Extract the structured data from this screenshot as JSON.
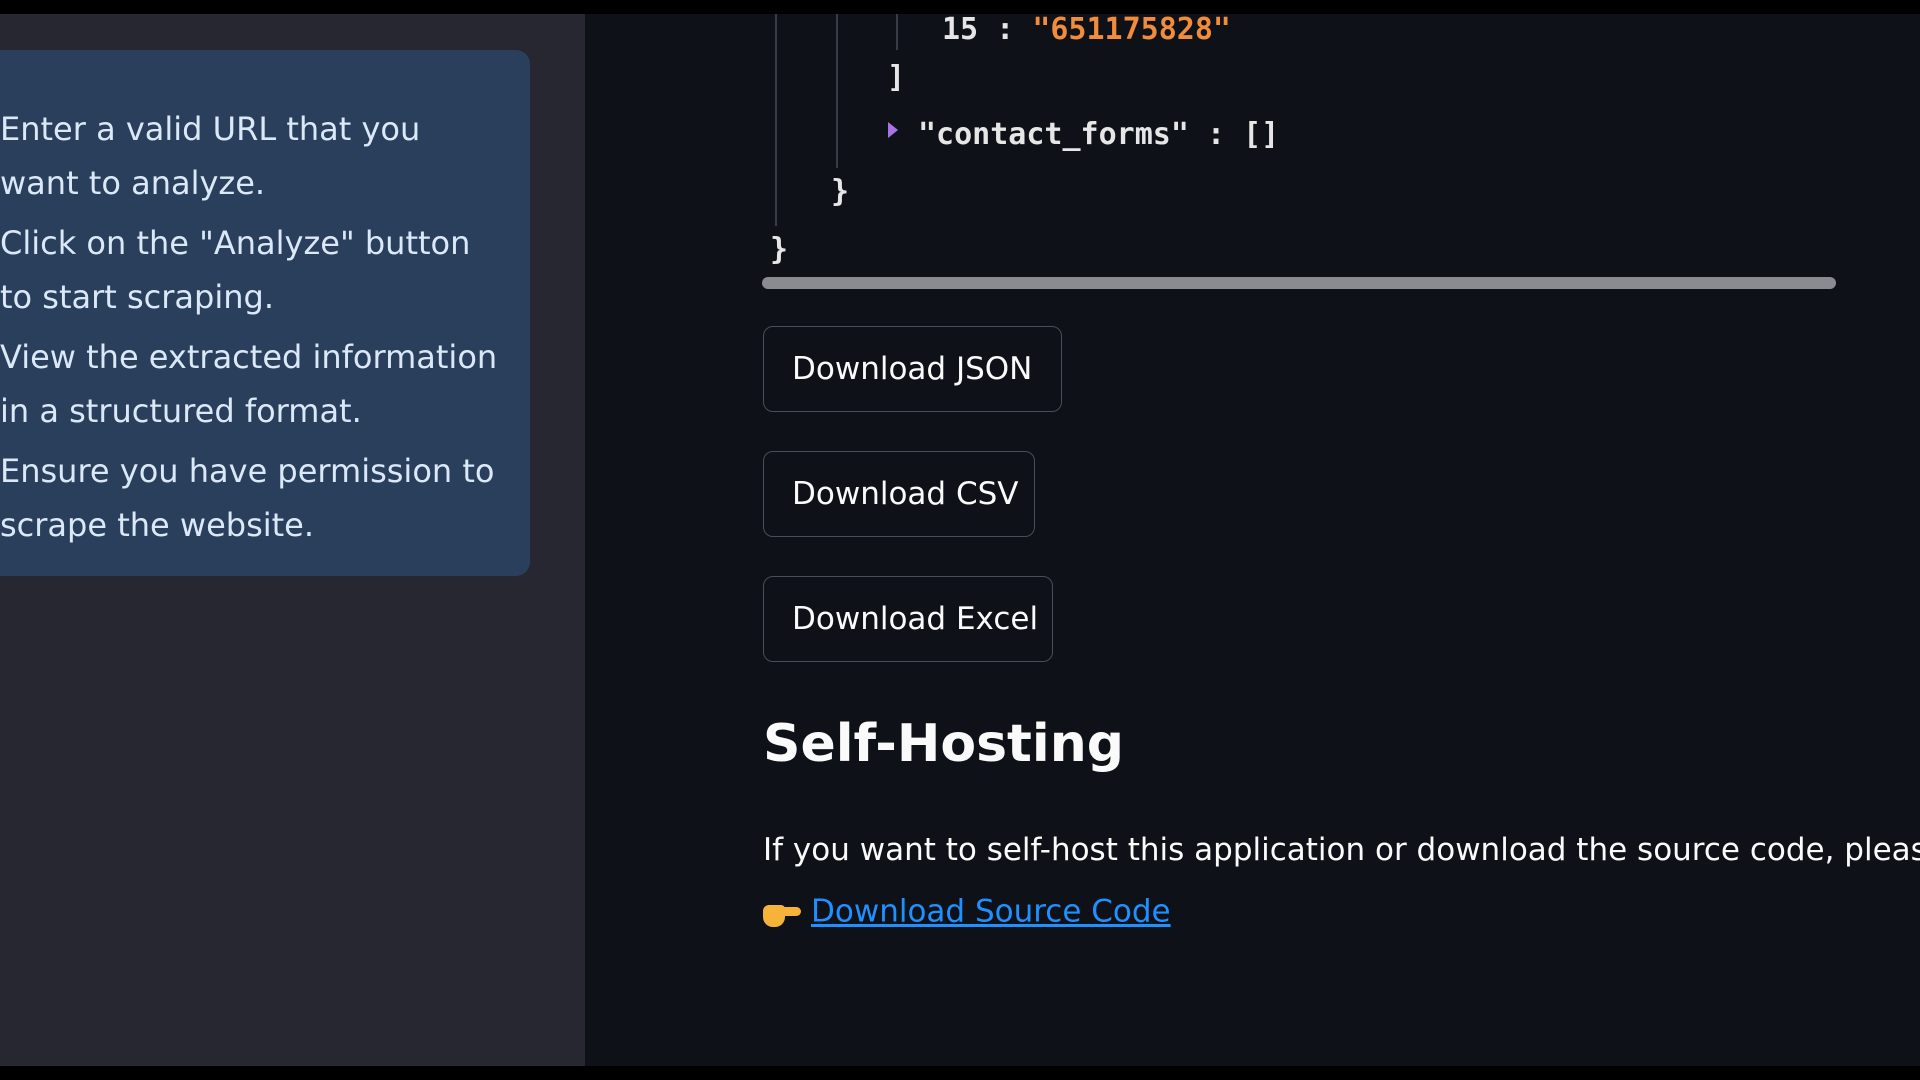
{
  "sidebar": {
    "info_steps": [
      "Enter a valid URL that you want to analyze.",
      "Click on the \"Analyze\" button to start scraping.",
      "View the extracted information in a structured format.",
      "Ensure you have permission to scrape the website."
    ]
  },
  "json_viewer": {
    "partial_entry_key": "15",
    "partial_entry_sep": " : ",
    "partial_entry_value": "\"651175828\"",
    "close_bracket": "]",
    "contact_forms_text": "\"contact_forms\" : []",
    "close_brace_inner": "}",
    "close_brace_outer": "}"
  },
  "downloads": {
    "json_label": "Download JSON",
    "csv_label": "Download CSV",
    "excel_label": "Download Excel"
  },
  "self_hosting": {
    "title": "Self-Hosting",
    "description": "If you want to self-host this application or download the source code, please vi",
    "link_label": "Download Source Code"
  },
  "colors": {
    "main_bg": "#0e1117",
    "sidebar_bg": "#262730",
    "info_box_bg": "#2a3f5c",
    "link": "#1e90ff",
    "json_string": "#f08c3c"
  }
}
